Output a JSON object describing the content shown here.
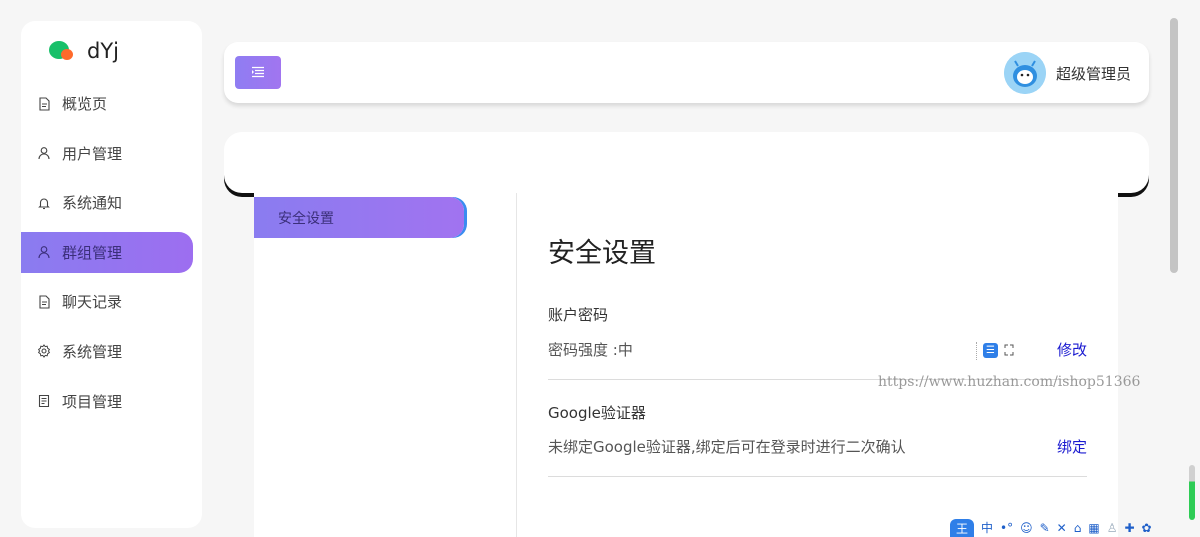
{
  "sidebar": {
    "logo_text": "dYj",
    "items": [
      {
        "label": "概览页",
        "icon": "document-icon",
        "active": false
      },
      {
        "label": "用户管理",
        "icon": "user-icon",
        "active": false
      },
      {
        "label": "系统通知",
        "icon": "bell-icon",
        "active": false
      },
      {
        "label": "群组管理",
        "icon": "user-icon",
        "active": true
      },
      {
        "label": "聊天记录",
        "icon": "document-icon",
        "active": false
      },
      {
        "label": "系统管理",
        "icon": "gear-icon",
        "active": false
      },
      {
        "label": "项目管理",
        "icon": "list-document-icon",
        "active": false
      }
    ]
  },
  "header": {
    "menu_icon": "menu-icon",
    "user_name": "超级管理员"
  },
  "settings": {
    "tabs": [
      {
        "label": "安全设置",
        "active": true
      }
    ],
    "section_title": "安全设置",
    "groups": [
      {
        "title": "账户密码",
        "description": "密码强度 :中",
        "action": "修改"
      },
      {
        "title": "Google验证器",
        "description": "未绑定Google验证器,绑定后可在登录时进行二次确认",
        "action": "绑定"
      }
    ]
  },
  "watermark": "https://www.huzhan.com/ishop51366",
  "ime_toolbar": {
    "logo": "王",
    "mode": "中",
    "icons": [
      "dot-icon",
      "smile-icon",
      "pen-icon",
      "tools-icon",
      "shirt-icon",
      "keyboard-icon",
      "user-icon",
      "shirt-icon",
      "gear-icon"
    ]
  },
  "colors": {
    "accent_start": "#8a7cf0",
    "accent_end": "#a173f0",
    "action_link": "#1a1ad0"
  }
}
